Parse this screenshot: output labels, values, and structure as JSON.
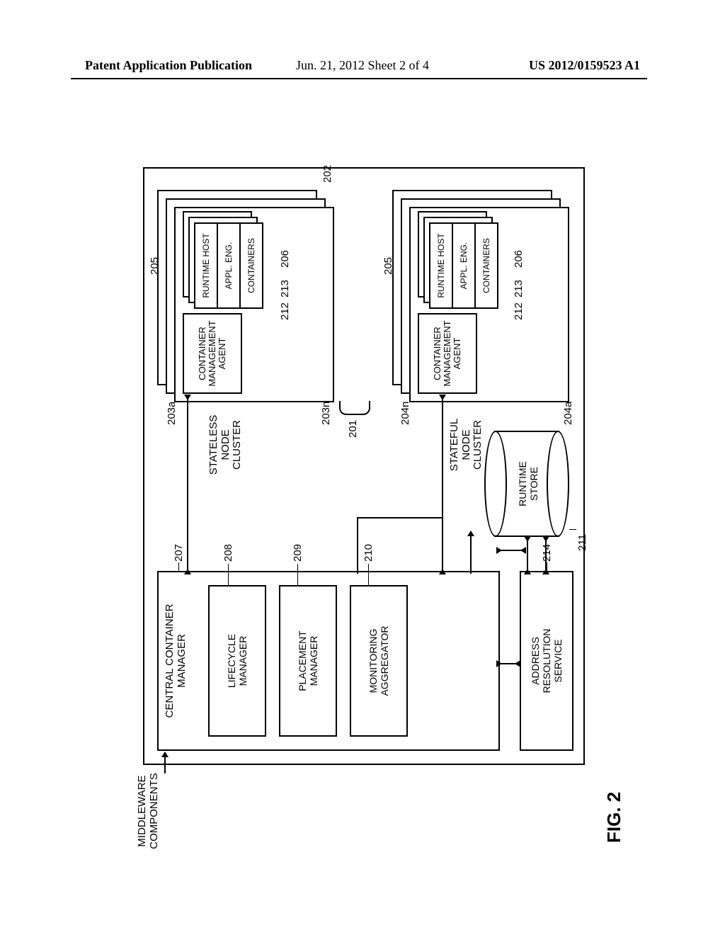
{
  "header": {
    "left": "Patent Application Publication",
    "mid": "Jun. 21, 2012  Sheet 2 of 4",
    "right": "US 2012/0159523 A1"
  },
  "fig_label": "FIG. 2",
  "middleware_label": "MIDDLEWARE\nCOMPONENTS",
  "ccm": {
    "title": "CENTRAL CONTAINER\nMANAGER",
    "lifecycle": "LIFECYCLE\nMANAGER",
    "placement": "PLACEMENT\nMANAGER",
    "monitoring": "MONITORING\nAGGREGATOR"
  },
  "ars": "ADDRESS\nRESOLUTION\nSERVICE",
  "store": "RUNTIME\nSTORE",
  "clusters": {
    "stateless_label": "STATELESS\nNODE\nCLUSTER",
    "stateful_label": "STATEFUL\nNODE\nCLUSTER",
    "cma": "CONTAINER\nMANAGEMENT\nAGENT",
    "host": "RUNTIME HOST",
    "eng": "APPL. ENG.",
    "containers": "CONTAINERS"
  },
  "refs": {
    "r201": "201",
    "r202": "202",
    "r203a": "203a",
    "r203n": "203n",
    "r204a": "204a",
    "r204n": "204n",
    "r205a": "205",
    "r205b": "205",
    "r206a": "206",
    "r206b": "206",
    "r207": "207",
    "r208": "208",
    "r209": "209",
    "r210": "210",
    "r211": "211",
    "r212a": "212",
    "r212b": "212",
    "r213a": "213",
    "r213b": "213",
    "r214": "214"
  },
  "chart_data": {
    "type": "diagram",
    "title": "FIG. 2",
    "nodes": [
      {
        "id": "middleware",
        "label": "MIDDLEWARE COMPONENTS",
        "external": true
      },
      {
        "id": "ccm",
        "ref": "207",
        "label": "CENTRAL CONTAINER MANAGER",
        "children": [
          {
            "id": "lifecycle",
            "ref": "208",
            "label": "LIFECYCLE MANAGER"
          },
          {
            "id": "placement",
            "ref": "209",
            "label": "PLACEMENT MANAGER"
          },
          {
            "id": "monitoring",
            "ref": "210",
            "label": "MONITORING AGGREGATOR"
          }
        ]
      },
      {
        "id": "ars",
        "ref": "214",
        "label": "ADDRESS RESOLUTION SERVICE"
      },
      {
        "id": "store",
        "ref": "211",
        "label": "RUNTIME STORE",
        "shape": "cylinder"
      },
      {
        "id": "stateless_cluster",
        "ref": "201",
        "label": "STATELESS NODE CLUSTER",
        "instances": [
          "203a",
          "203n"
        ],
        "components": [
          {
            "id": "cma",
            "ref": "205",
            "label": "CONTAINER MANAGEMENT AGENT"
          },
          {
            "id": "runtime_host",
            "ref": "212",
            "label": "RUNTIME HOST",
            "multi": true,
            "children": [
              {
                "id": "appl_eng",
                "ref": "213",
                "label": "APPL. ENG."
              },
              {
                "id": "containers",
                "ref": "206",
                "label": "CONTAINERS"
              }
            ]
          }
        ]
      },
      {
        "id": "stateful_cluster",
        "ref": "202",
        "label": "STATEFUL NODE CLUSTER",
        "instances": [
          "204a",
          "204n"
        ],
        "components": [
          {
            "id": "cma",
            "ref": "205",
            "label": "CONTAINER MANAGEMENT AGENT"
          },
          {
            "id": "runtime_host",
            "ref": "212",
            "label": "RUNTIME HOST",
            "multi": true,
            "children": [
              {
                "id": "appl_eng",
                "ref": "213",
                "label": "APPL. ENG."
              },
              {
                "id": "containers",
                "ref": "206",
                "label": "CONTAINERS"
              }
            ]
          }
        ]
      }
    ],
    "edges": [
      {
        "from": "middleware",
        "to": "ccm",
        "dir": "uni"
      },
      {
        "from": "ccm",
        "to": "stateless_cluster.cma",
        "dir": "bi"
      },
      {
        "from": "ccm",
        "to": "stateful_cluster.cma",
        "dir": "bi"
      },
      {
        "from": "ccm",
        "to": "store",
        "dir": "bi"
      },
      {
        "from": "ars",
        "to": "store",
        "dir": "bi"
      },
      {
        "from": "ccm",
        "to": "ars",
        "dir": "bi"
      }
    ]
  }
}
